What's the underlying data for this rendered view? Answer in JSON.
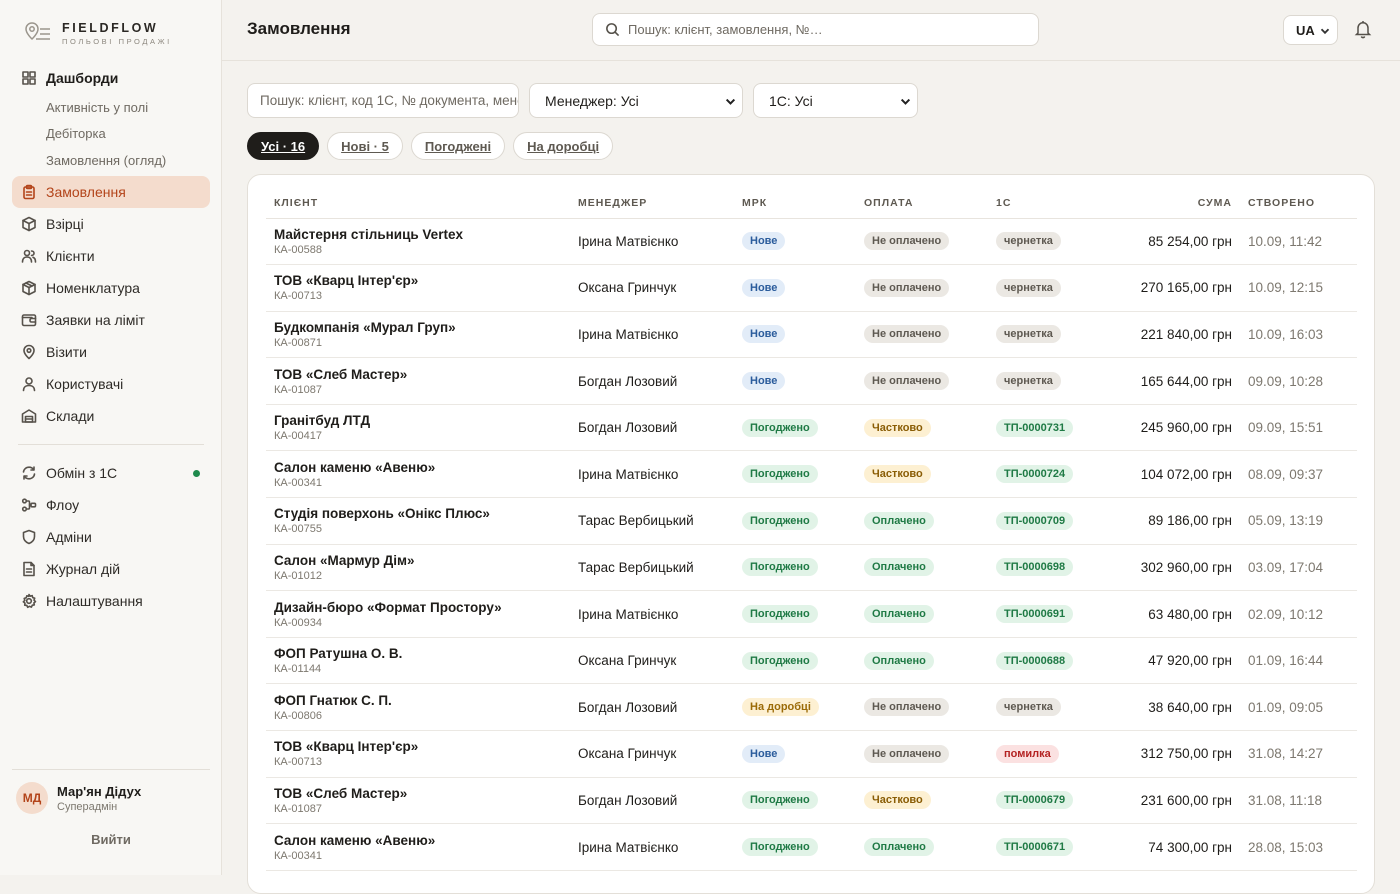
{
  "brand": {
    "name": "FIELDFLOW",
    "tagline": "ПОЛЬОВІ ПРОДАЖІ"
  },
  "sidebar": {
    "dashboards": {
      "label": "Дашборди",
      "icon": "grid-icon"
    },
    "dashboard_subs": [
      "Активність у полі",
      "Дебіторка",
      "Замовлення (огляд)"
    ],
    "items": [
      {
        "label": "Замовлення",
        "icon": "clipboard-icon",
        "active": true
      },
      {
        "label": "Взірці",
        "icon": "box-icon"
      },
      {
        "label": "Клієнти",
        "icon": "users-icon"
      },
      {
        "label": "Номенклатура",
        "icon": "cube-icon"
      },
      {
        "label": "Заявки на ліміт",
        "icon": "wallet-icon"
      },
      {
        "label": "Візити",
        "icon": "map-pin-icon"
      },
      {
        "label": "Користувачі",
        "icon": "user-icon"
      },
      {
        "label": "Склади",
        "icon": "warehouse-icon"
      }
    ],
    "items2": [
      {
        "label": "Обмін з 1С",
        "icon": "sync-icon",
        "status_dot": "#1f8a4c"
      },
      {
        "label": "Флоу",
        "icon": "flow-icon"
      },
      {
        "label": "Адміни",
        "icon": "shield-icon"
      },
      {
        "label": "Журнал дій",
        "icon": "file-icon"
      },
      {
        "label": "Налаштування",
        "icon": "gear-icon"
      }
    ],
    "user": {
      "initials": "МД",
      "name": "Мар'ян Дідух",
      "role": "Суперадмін"
    },
    "logout": "Вийти"
  },
  "header": {
    "title": "Замовлення",
    "search_placeholder": "Пошук: клієнт, замовлення, №…",
    "lang": "UA"
  },
  "filters": {
    "search_placeholder": "Пошук: клієнт, код 1С, № документа, менеджер",
    "manager": "Менеджер: Усі",
    "onec": "1С: Усі",
    "chips": [
      {
        "label": "Усі · 16",
        "active": true
      },
      {
        "label": "Нові · 5",
        "active": false
      },
      {
        "label": "Погоджені",
        "active": false
      },
      {
        "label": "На доробці",
        "active": false
      }
    ]
  },
  "table": {
    "columns": [
      "КЛІЄНТ",
      "МЕНЕДЖЕР",
      "МРК",
      "ОПЛАТА",
      "1С",
      "СУМА",
      "СТВОРЕНО"
    ],
    "rows": [
      {
        "client": "Майстерня стільниць Vertex",
        "code": "КА-00588",
        "manager": "Ірина Матвієнко",
        "mrk": "Нове",
        "mrk_t": "new",
        "pay": "Не оплачено",
        "pay_t": "unpaid",
        "onec": "чернетка",
        "onec_t": "draft",
        "sum": "85 254,00 грн",
        "created": "10.09, 11:42"
      },
      {
        "client": "ТОВ «Кварц Інтер'єр»",
        "code": "КА-00713",
        "manager": "Оксана Гринчук",
        "mrk": "Нове",
        "mrk_t": "new",
        "pay": "Не оплачено",
        "pay_t": "unpaid",
        "onec": "чернетка",
        "onec_t": "draft",
        "sum": "270 165,00 грн",
        "created": "10.09, 12:15"
      },
      {
        "client": "Будкомпанія «Мурал Груп»",
        "code": "КА-00871",
        "manager": "Ірина Матвієнко",
        "mrk": "Нове",
        "mrk_t": "new",
        "pay": "Не оплачено",
        "pay_t": "unpaid",
        "onec": "чернетка",
        "onec_t": "draft",
        "sum": "221 840,00 грн",
        "created": "10.09, 16:03"
      },
      {
        "client": "ТОВ «Слеб Мастер»",
        "code": "КА-01087",
        "manager": "Богдан Лозовий",
        "mrk": "Нове",
        "mrk_t": "new",
        "pay": "Не оплачено",
        "pay_t": "unpaid",
        "onec": "чернетка",
        "onec_t": "draft",
        "sum": "165 644,00 грн",
        "created": "09.09, 10:28"
      },
      {
        "client": "Гранітбуд ЛТД",
        "code": "КА-00417",
        "manager": "Богдан Лозовий",
        "mrk": "Погоджено",
        "mrk_t": "ok",
        "pay": "Частково",
        "pay_t": "partial",
        "onec": "ТП-0000731",
        "onec_t": "tp",
        "sum": "245 960,00 грн",
        "created": "09.09, 15:51"
      },
      {
        "client": "Салон каменю «Авеню»",
        "code": "КА-00341",
        "manager": "Ірина Матвієнко",
        "mrk": "Погоджено",
        "mrk_t": "ok",
        "pay": "Частково",
        "pay_t": "partial",
        "onec": "ТП-0000724",
        "onec_t": "tp",
        "sum": "104 072,00 грн",
        "created": "08.09, 09:37"
      },
      {
        "client": "Студія поверхонь «Онікс Плюс»",
        "code": "КА-00755",
        "manager": "Тарас Вербицький",
        "mrk": "Погоджено",
        "mrk_t": "ok",
        "pay": "Оплачено",
        "pay_t": "paid",
        "onec": "ТП-0000709",
        "onec_t": "tp",
        "sum": "89 186,00 грн",
        "created": "05.09, 13:19"
      },
      {
        "client": "Салон «Мармур Дім»",
        "code": "КА-01012",
        "manager": "Тарас Вербицький",
        "mrk": "Погоджено",
        "mrk_t": "ok",
        "pay": "Оплачено",
        "pay_t": "paid",
        "onec": "ТП-0000698",
        "onec_t": "tp",
        "sum": "302 960,00 грн",
        "created": "03.09, 17:04"
      },
      {
        "client": "Дизайн-бюро «Формат Простору»",
        "code": "КА-00934",
        "manager": "Ірина Матвієнко",
        "mrk": "Погоджено",
        "mrk_t": "ok",
        "pay": "Оплачено",
        "pay_t": "paid",
        "onec": "ТП-0000691",
        "onec_t": "tp",
        "sum": "63 480,00 грн",
        "created": "02.09, 10:12"
      },
      {
        "client": "ФОП Ратушна О. В.",
        "code": "КА-01144",
        "manager": "Оксана Гринчук",
        "mrk": "Погоджено",
        "mrk_t": "ok",
        "pay": "Оплачено",
        "pay_t": "paid",
        "onec": "ТП-0000688",
        "onec_t": "tp",
        "sum": "47 920,00 грн",
        "created": "01.09, 16:44"
      },
      {
        "client": "ФОП Гнатюк С. П.",
        "code": "КА-00806",
        "manager": "Богдан Лозовий",
        "mrk": "На доробці",
        "mrk_t": "rework",
        "pay": "Не оплачено",
        "pay_t": "unpaid",
        "onec": "чернетка",
        "onec_t": "draft",
        "sum": "38 640,00 грн",
        "created": "01.09, 09:05"
      },
      {
        "client": "ТОВ «Кварц Інтер'єр»",
        "code": "КА-00713",
        "manager": "Оксана Гринчук",
        "mrk": "Нове",
        "mrk_t": "new",
        "pay": "Не оплачено",
        "pay_t": "unpaid",
        "onec": "помилка",
        "onec_t": "err",
        "sum": "312 750,00 грн",
        "created": "31.08, 14:27"
      },
      {
        "client": "ТОВ «Слеб Мастер»",
        "code": "КА-01087",
        "manager": "Богдан Лозовий",
        "mrk": "Погоджено",
        "mrk_t": "ok",
        "pay": "Частково",
        "pay_t": "partial",
        "onec": "ТП-0000679",
        "onec_t": "tp",
        "sum": "231 600,00 грн",
        "created": "31.08, 11:18"
      },
      {
        "client": "Салон каменю «Авеню»",
        "code": "КА-00341",
        "manager": "Ірина Матвієнко",
        "mrk": "Погоджено",
        "mrk_t": "ok",
        "pay": "Оплачено",
        "pay_t": "paid",
        "onec": "ТП-0000671",
        "onec_t": "tp",
        "sum": "74 300,00 грн",
        "created": "28.08, 15:03"
      }
    ]
  }
}
